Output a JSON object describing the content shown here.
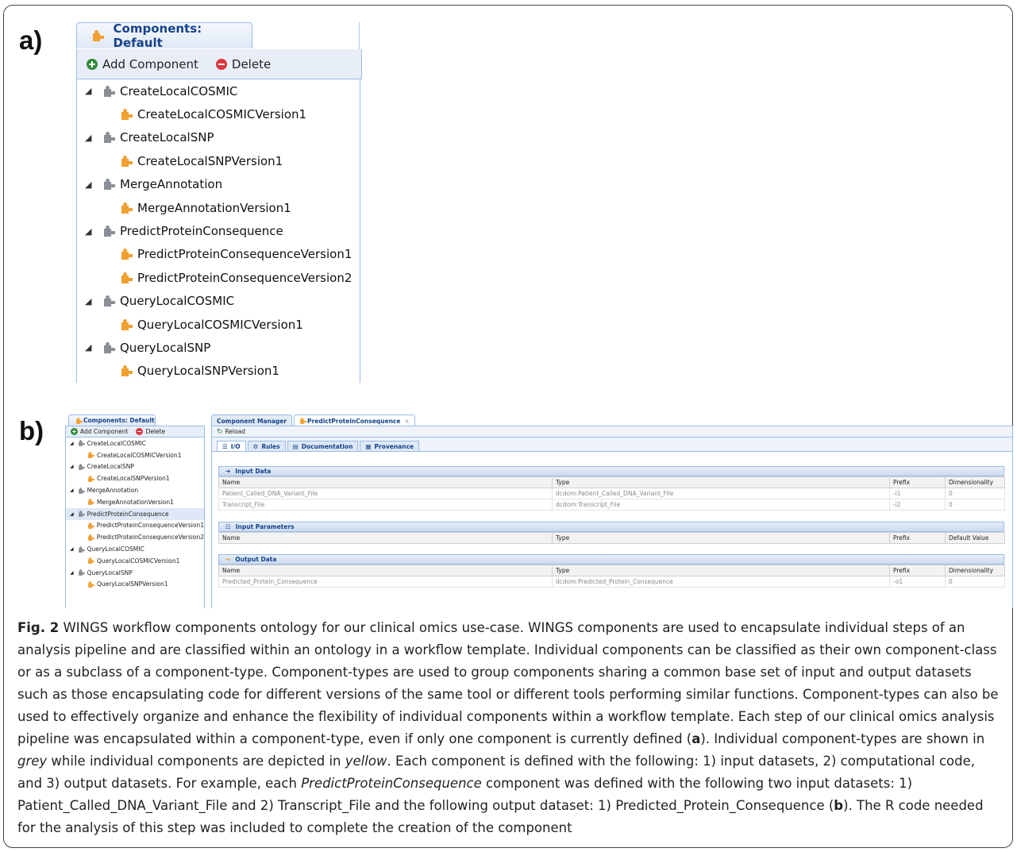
{
  "panel_labels": {
    "a": "a)",
    "b": "b)"
  },
  "panel_a": {
    "tab_title": "Components: Default",
    "toolbar": {
      "add_label": "Add Component",
      "delete_label": "Delete"
    },
    "tree": [
      {
        "type": "class",
        "label": "CreateLocalCOSMIC"
      },
      {
        "type": "component",
        "label": "CreateLocalCOSMICVersion1"
      },
      {
        "type": "class",
        "label": "CreateLocalSNP"
      },
      {
        "type": "component",
        "label": "CreateLocalSNPVersion1"
      },
      {
        "type": "class",
        "label": "MergeAnnotation"
      },
      {
        "type": "component",
        "label": "MergeAnnotationVersion1"
      },
      {
        "type": "class",
        "label": "PredictProteinConsequence"
      },
      {
        "type": "component",
        "label": "PredictProteinConsequenceVersion1"
      },
      {
        "type": "component",
        "label": "PredictProteinConsequenceVersion2"
      },
      {
        "type": "class",
        "label": "QueryLocalCOSMIC"
      },
      {
        "type": "component",
        "label": "QueryLocalCOSMICVersion1"
      },
      {
        "type": "class",
        "label": "QueryLocalSNP"
      },
      {
        "type": "component",
        "label": "QueryLocalSNPVersion1"
      }
    ]
  },
  "panel_b": {
    "left_tab_title": "Components: Default",
    "toolbar": {
      "add_label": "Add Component",
      "delete_label": "Delete"
    },
    "tabs": [
      "Component Manager",
      "PredictProteinConsequence"
    ],
    "reload_label": "Reload",
    "subtabs": [
      "I/O",
      "Rules",
      "Documentation",
      "Provenance"
    ],
    "input_data": {
      "title": "Input Data",
      "columns": [
        "Name",
        "Type",
        "Prefix",
        "Dimensionality"
      ],
      "rows": [
        [
          "Patient_Called_DNA_Variant_File",
          "dcdom:Patient_Called_DNA_Variant_File",
          "-i1",
          "0"
        ],
        [
          "Transcript_File",
          "dcdom:Transcript_File",
          "-i2",
          "0"
        ]
      ]
    },
    "input_parameters": {
      "title": "Input Parameters",
      "columns": [
        "Name",
        "Type",
        "Prefix",
        "Default Value"
      ]
    },
    "output_data": {
      "title": "Output Data",
      "columns": [
        "Name",
        "Type",
        "Prefix",
        "Dimensionality"
      ],
      "rows": [
        [
          "Predicted_Protein_Consequence",
          "dcdom:Predicted_Protein_Consequence",
          "-o1",
          "0"
        ]
      ]
    }
  },
  "caption": {
    "fig_label": "Fig. 2",
    "p1": " WINGS workflow components ontology for our clinical omics use-case. WINGS components are used to encapsulate individual steps of an analysis pipeline and are classified within an ontology in a workflow template. Individual components can be classified as their own component-class or as a subclass of a component-type. Component-types are used to group components sharing a common base set of input and output datasets such as those encapsulating code for different versions of the same tool or different tools performing similar functions. Component-types can also be used to effectively organize and enhance the flexibility of individual components within a workflow template. Each step of our clinical omics analysis pipeline was encapsulated within a component-type, even if only one component is currently defined (",
    "ref_a": "a",
    "p2": "). Individual component-types are shown in ",
    "grey": "grey",
    "p3": " while individual components are depicted in ",
    "yellow": "yellow",
    "p4": ". Each component is defined with the following: 1) input datasets, 2) computational code, and 3) output datasets. For example, each ",
    "ppc": "PredictProteinConsequence",
    "p5": " component was defined with the following two input datasets: 1) Patient_Called_DNA_Variant_File and 2) Transcript_File and the following output dataset: 1) Predicted_Protein_Consequence (",
    "ref_b": "b",
    "p6": "). The R code needed for the analysis of this step was included to complete the creation of the component"
  },
  "colors": {
    "component_type": "#8a8f96",
    "component": "#f0a030",
    "tab_text": "#15428b",
    "border": "#99bbe8"
  }
}
